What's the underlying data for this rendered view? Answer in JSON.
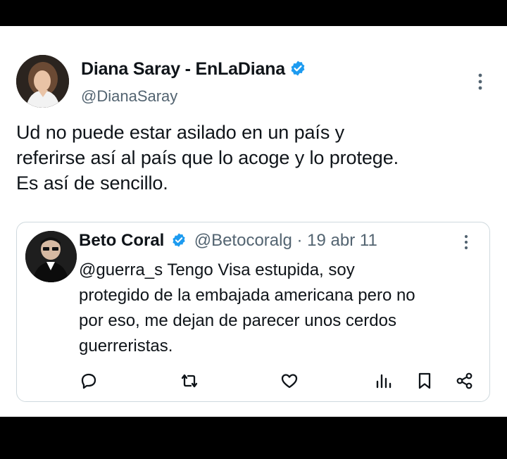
{
  "tweet": {
    "author_name": "Diana Saray - EnLaDiana",
    "author_handle": "@DianaSaray",
    "text_lines": [
      "Ud no puede estar asilado en un país y",
      "referirse así al país que lo acoge y lo protege.",
      "Es así de sencillo."
    ]
  },
  "quoted": {
    "author_name": "Beto Coral",
    "author_handle": "@Betocoralg",
    "separator": "·",
    "date": "19 abr 11",
    "text_lines": [
      "@guerra_s Tengo Visa estupida, soy",
      "protegido de la embajada americana pero no",
      "por eso, me dejan de parecer unos cerdos",
      "guerreristas."
    ]
  },
  "actions": [
    "reply-icon",
    "retweet-icon",
    "like-icon",
    "views-icon",
    "bookmark-icon",
    "share-icon"
  ],
  "colors": {
    "verified": "#1d9bf0",
    "text": "#0f1419",
    "secondary": "#536471",
    "border": "#cfd9de",
    "frame": "#000000"
  }
}
